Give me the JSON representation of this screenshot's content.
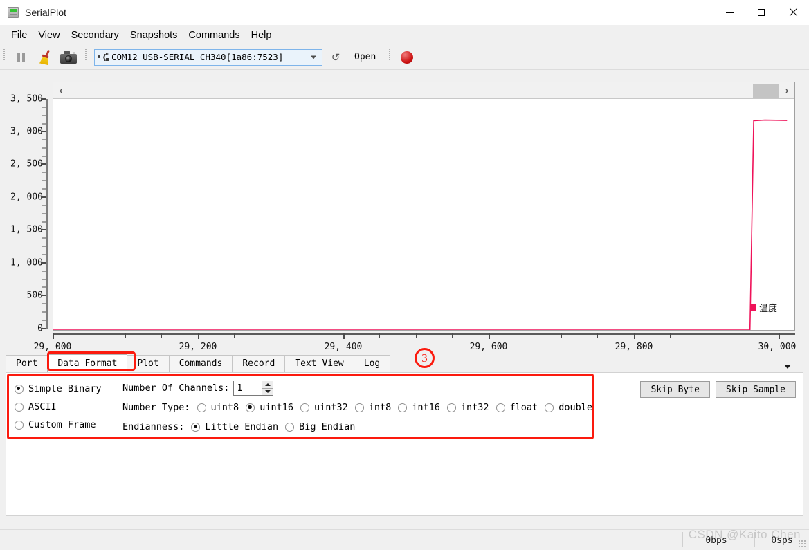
{
  "window": {
    "title": "SerialPlot",
    "icon": "app-icon",
    "minimize": "—",
    "maximize": "□",
    "close": "✕"
  },
  "menubar": {
    "items": [
      {
        "label": "File",
        "mnemonic": "F",
        "rest": "ile"
      },
      {
        "label": "View",
        "mnemonic": "V",
        "rest": "iew"
      },
      {
        "label": "Secondary",
        "mnemonic": "S",
        "rest": "econdary"
      },
      {
        "label": "Snapshots",
        "mnemonic": "S",
        "rest": "napshots"
      },
      {
        "label": "Commands",
        "mnemonic": "C",
        "rest": "ommands"
      },
      {
        "label": "Help",
        "mnemonic": "H",
        "rest": "elp"
      }
    ]
  },
  "toolbar": {
    "pause_icon": "pause-icon",
    "clear_icon": "broom-icon",
    "snapshot_icon": "camera-icon",
    "port_value": "COM12 USB-SERIAL CH340[1a86:7523]",
    "port_icon": "usb-icon",
    "reload_icon": "↺",
    "open_label": "Open",
    "record_icon": "record-dot-icon"
  },
  "plot": {
    "scroll_left_icon": "‹",
    "scroll_right_icon": "›",
    "legend": [
      {
        "label": "温度",
        "color": "#ef1259"
      }
    ],
    "series_color": "#ef1259"
  },
  "chart_data": {
    "type": "line",
    "title": "",
    "xlabel": "",
    "ylabel": "",
    "xlim": [
      29000,
      30000
    ],
    "ylim": [
      0,
      3600
    ],
    "xticks": [
      29000,
      29200,
      29400,
      29600,
      29800,
      30000
    ],
    "xtick_labels": [
      "29, 000",
      "29, 200",
      "29, 400",
      "29, 600",
      "29, 800",
      "30, 000"
    ],
    "yticks": [
      0,
      500,
      1000,
      1500,
      2000,
      2500,
      3000,
      3500
    ],
    "ytick_labels": [
      "0",
      "500",
      "1, 000",
      "1, 500",
      "2, 000",
      "2, 500",
      "3, 000",
      "3, 500"
    ],
    "grid": false,
    "legend_position": "inside-right",
    "series": [
      {
        "name": "温度",
        "color": "#ef1259",
        "x": [
          29000,
          29940,
          29945,
          29960,
          29990
        ],
        "y": [
          0,
          0,
          3260,
          3270,
          3265
        ]
      }
    ]
  },
  "tabs": {
    "items": [
      {
        "label": "Port",
        "active": false
      },
      {
        "label": "Data Format",
        "active": true
      },
      {
        "label": "Plot",
        "active": false
      },
      {
        "label": "Commands",
        "active": false
      },
      {
        "label": "Record",
        "active": false
      },
      {
        "label": "Text View",
        "active": false
      },
      {
        "label": "Log",
        "active": false
      }
    ],
    "overflow_icon": "chevron-down-icon"
  },
  "data_format": {
    "format_options": [
      {
        "label": "Simple Binary",
        "checked": true
      },
      {
        "label": "ASCII",
        "checked": false
      },
      {
        "label": "Custom Frame",
        "checked": false
      }
    ],
    "channels_label": "Number Of Channels:",
    "channels_value": "1",
    "number_type_label": "Number Type:",
    "number_types": [
      {
        "label": "uint8",
        "checked": false
      },
      {
        "label": "uint16",
        "checked": true
      },
      {
        "label": "uint32",
        "checked": false
      },
      {
        "label": "int8",
        "checked": false
      },
      {
        "label": "int16",
        "checked": false
      },
      {
        "label": "int32",
        "checked": false
      },
      {
        "label": "float",
        "checked": false
      },
      {
        "label": "double",
        "checked": false
      }
    ],
    "endianness_label": "Endianness:",
    "endianness": [
      {
        "label": "Little Endian",
        "checked": true
      },
      {
        "label": "Big Endian",
        "checked": false
      }
    ],
    "skip_byte_label": "Skip Byte",
    "skip_sample_label": "Skip Sample"
  },
  "annotations": {
    "step_number": "3",
    "color": "#fb1a0e"
  },
  "statusbar": {
    "bitrate": "0bps",
    "samplerate": "0sps",
    "watermark": "CSDN @Kaito Chen"
  }
}
